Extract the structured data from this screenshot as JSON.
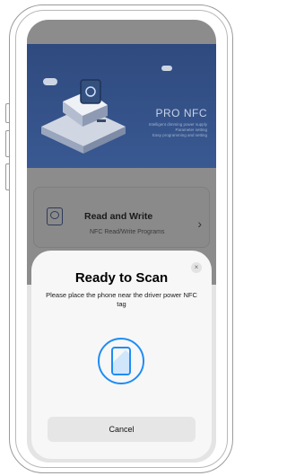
{
  "banner": {
    "title": "PRO NFC",
    "lines": [
      "Intelligent dimming power supply",
      "Parameter setting",
      "Easy programming and setting"
    ]
  },
  "card": {
    "title": "Read and Write",
    "subtitle": "NFC Read/Write Programs",
    "chevron": "›",
    "icon": "nfc-tag-icon"
  },
  "sheet": {
    "title": "Ready to Scan",
    "message": "Please place the phone near the driver power NFC tag",
    "close": "×",
    "cancel": "Cancel",
    "icon": "phone-scan-icon",
    "accent": "#1e8df5"
  }
}
